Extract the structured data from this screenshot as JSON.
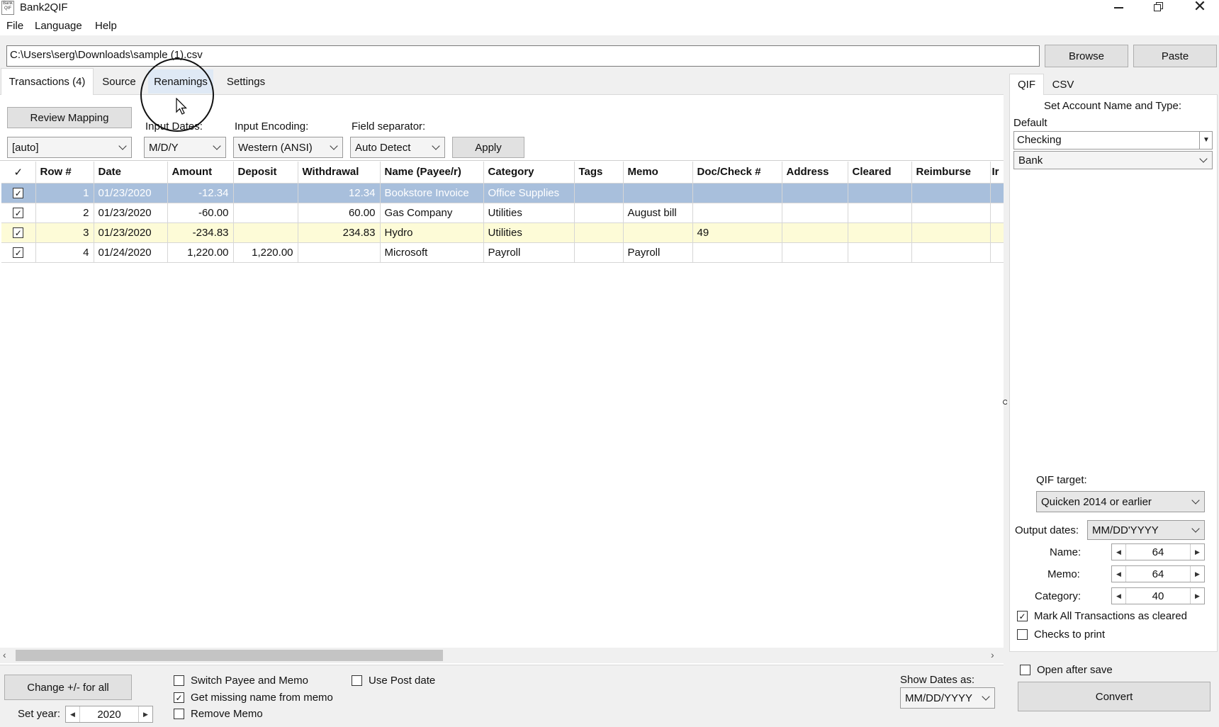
{
  "window": {
    "title": "Bank2QIF",
    "icon_text": "Bank QIF"
  },
  "menu": [
    "File",
    "Language",
    "Help"
  ],
  "file_path": "C:\\Users\\serg\\Downloads\\sample (1).csv",
  "buttons": {
    "browse": "Browse",
    "paste": "Paste",
    "review_mapping": "Review Mapping",
    "apply": "Apply",
    "change_sign": "Change +/- for all",
    "convert": "Convert"
  },
  "tabs": [
    "Transactions (4)",
    "Source",
    "Renamings",
    "Settings"
  ],
  "active_tab": "Transactions (4)",
  "options": {
    "mapping_value": "[auto]",
    "input_dates_label": "Input Dates:",
    "input_dates_value": "M/D/Y",
    "input_encoding_label": "Input Encoding:",
    "input_encoding_value": "Western (ANSI)",
    "field_separator_label": "Field separator:",
    "field_separator_value": "Auto Detect"
  },
  "table": {
    "columns": [
      "✓",
      "Row #",
      "Date",
      "Amount",
      "Deposit",
      "Withdrawal",
      "Name (Payee/r)",
      "Category",
      "Tags",
      "Memo",
      "Doc/Check #",
      "Address",
      "Cleared",
      "Reimburse",
      "Ir"
    ],
    "rows": [
      {
        "checked": true,
        "row": "1",
        "date": "01/23/2020",
        "amount": "-12.34",
        "deposit": "",
        "withdrawal": "12.34",
        "name": "Bookstore Invoice",
        "category": "Office Supplies",
        "tags": "",
        "memo": "",
        "doc": "",
        "address": "",
        "cleared": "",
        "reimburse": "",
        "state": "selected"
      },
      {
        "checked": true,
        "row": "2",
        "date": "01/23/2020",
        "amount": "-60.00",
        "deposit": "",
        "withdrawal": "60.00",
        "name": "Gas Company",
        "category": "Utilities",
        "tags": "",
        "memo": "August bill",
        "doc": "",
        "address": "",
        "cleared": "",
        "reimburse": "",
        "state": "normal"
      },
      {
        "checked": true,
        "row": "3",
        "date": "01/23/2020",
        "amount": "-234.83",
        "deposit": "",
        "withdrawal": "234.83",
        "name": "Hydro",
        "category": "Utilities",
        "tags": "",
        "memo": "",
        "doc": "49",
        "address": "",
        "cleared": "",
        "reimburse": "",
        "state": "highlighted"
      },
      {
        "checked": true,
        "row": "4",
        "date": "01/24/2020",
        "amount": "1,220.00",
        "deposit": "1,220.00",
        "withdrawal": "",
        "name": "Microsoft",
        "category": "Payroll",
        "tags": "",
        "memo": "Payroll",
        "doc": "",
        "address": "",
        "cleared": "",
        "reimburse": "",
        "state": "normal"
      }
    ]
  },
  "bottom": {
    "set_year_label": "Set year:",
    "set_year_value": "2020",
    "switch_payee_memo": {
      "label": "Switch Payee and Memo",
      "checked": false
    },
    "get_missing_name": {
      "label": "Get missing name from memo",
      "checked": true
    },
    "remove_memo": {
      "label": "Remove Memo",
      "checked": false
    },
    "use_post_date": {
      "label": "Use Post date",
      "checked": false
    },
    "show_dates_label": "Show Dates as:",
    "show_dates_value": "MM/DD/YYYY"
  },
  "right_panel": {
    "tabs": [
      "QIF",
      "CSV"
    ],
    "heading": "Set Account Name and Type:",
    "default_label": "Default",
    "account_name": "Checking",
    "account_type": "Bank",
    "qif_target_label": "QIF target:",
    "qif_target_value": "Quicken 2014 or earlier",
    "output_dates_label": "Output dates:",
    "output_dates_value": "MM/DD'YYYY",
    "name_label": "Name:",
    "name_value": "64",
    "memo_label": "Memo:",
    "memo_value": "64",
    "category_label": "Category:",
    "category_value": "40",
    "mark_cleared": {
      "label": "Mark All Transactions as cleared",
      "checked": true
    },
    "checks_to_print": {
      "label": "Checks to print",
      "checked": false
    },
    "open_after_save": {
      "label": "Open after save",
      "checked": false
    }
  },
  "colors": {
    "selected_row": "#a8bfdc",
    "highlighted_row": "#fdfbd7",
    "button_face": "#e1e1e1"
  }
}
